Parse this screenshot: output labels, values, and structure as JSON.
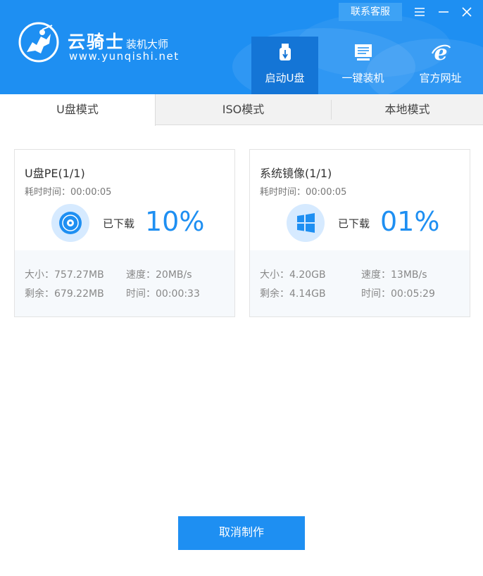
{
  "header": {
    "brand_name": "云骑士",
    "brand_sub": "装机大师",
    "brand_url": "www.yunqishi.net",
    "contact_label": "联系客服",
    "colors": {
      "primary": "#1e8ff2",
      "active_nav": "#1475d6"
    },
    "nav": [
      {
        "label": "启动U盘",
        "icon": "usb-drive-icon",
        "active": true
      },
      {
        "label": "一键装机",
        "icon": "monitor-icon",
        "active": false
      },
      {
        "label": "官方网址",
        "icon": "ie-browser-icon",
        "active": false
      }
    ]
  },
  "tabs": [
    {
      "label": "U盘模式",
      "active": true
    },
    {
      "label": "ISO模式",
      "active": false
    },
    {
      "label": "本地模式",
      "active": false
    }
  ],
  "cards": [
    {
      "title": "U盘PE(1/1)",
      "elapsed": "耗时时间：00:00:05",
      "icon": "disc-icon",
      "downloaded_label": "已下载",
      "percent": "10%",
      "size": "大小：757.27MB",
      "speed": "速度：20MB/s",
      "remaining": "剩余：679.22MB",
      "time": "时间：00:00:33"
    },
    {
      "title": "系统镜像(1/1)",
      "elapsed": "耗时时间：00:00:05",
      "icon": "windows-logo-icon",
      "downloaded_label": "已下载",
      "percent": "01%",
      "size": "大小：4.20GB",
      "speed": "速度：13MB/s",
      "remaining": "剩余：4.14GB",
      "time": "时间：00:05:29"
    }
  ],
  "cancel_label": "取消制作"
}
